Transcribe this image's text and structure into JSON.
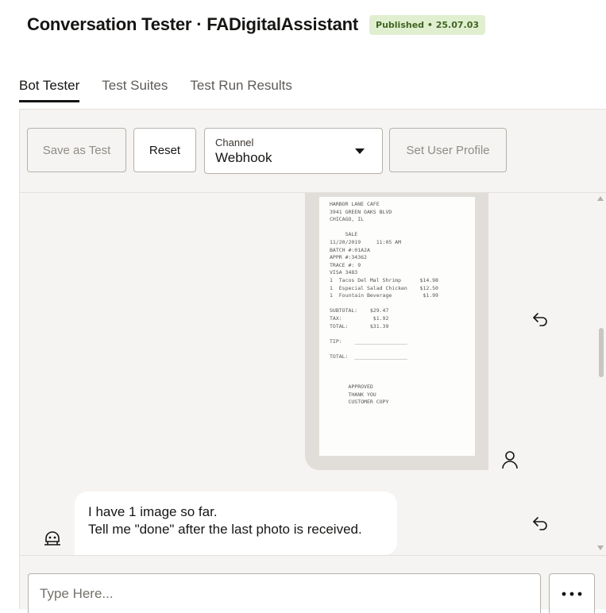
{
  "header": {
    "title": "Conversation Tester · FADigitalAssistant",
    "badge": "Published • 25.07.03"
  },
  "tabs": [
    {
      "label": "Bot Tester",
      "active": true
    },
    {
      "label": "Test Suites",
      "active": false
    },
    {
      "label": "Test Run Results",
      "active": false
    }
  ],
  "toolbar": {
    "save_label": "Save as Test",
    "reset_label": "Reset",
    "channel_label": "Channel",
    "channel_value": "Webhook",
    "profile_label": "Set User Profile"
  },
  "conversation": {
    "user_image": {
      "receipt_lines": [
        "HARBOR LANE CAFE",
        "3941 GREEN OAKS BLVD",
        "CHICAGO, IL",
        "",
        "     SALE",
        "11/20/2019     11:05 AM",
        "BATCH #:01A2A",
        "APPR #:34362",
        "TRACE #: 9",
        "VISA 3483",
        "1  Tacos Del Mal Shrimp      $14.98",
        "1  Especial Salad Chicken    $12.50",
        "1  Fountain Beverage          $1.99",
        "",
        "SUBTOTAL:    $29.47",
        "TAX:          $1.92",
        "TOTAL:       $31.39",
        "",
        "TIP:    _________________",
        "",
        "TOTAL:  _________________",
        "",
        "",
        "",
        "      APPROVED",
        "      THANK YOU",
        "      CUSTOMER COPY"
      ]
    },
    "bot_message": {
      "lines": [
        "I have 1 image so far.",
        "Tell me \"done\" after the last photo is received."
      ]
    }
  },
  "input": {
    "placeholder": "Type Here..."
  },
  "icons": {
    "reply": "reply-arrow-icon",
    "user": "user-avatar-icon",
    "bot": "bot-avatar-icon",
    "more": "more-options-icon"
  },
  "colors": {
    "badge_bg": "#e1efd1",
    "badge_text": "#3f6522",
    "panel_bg": "#f5f4f2",
    "image_bubble_bg": "#e1ded9"
  }
}
